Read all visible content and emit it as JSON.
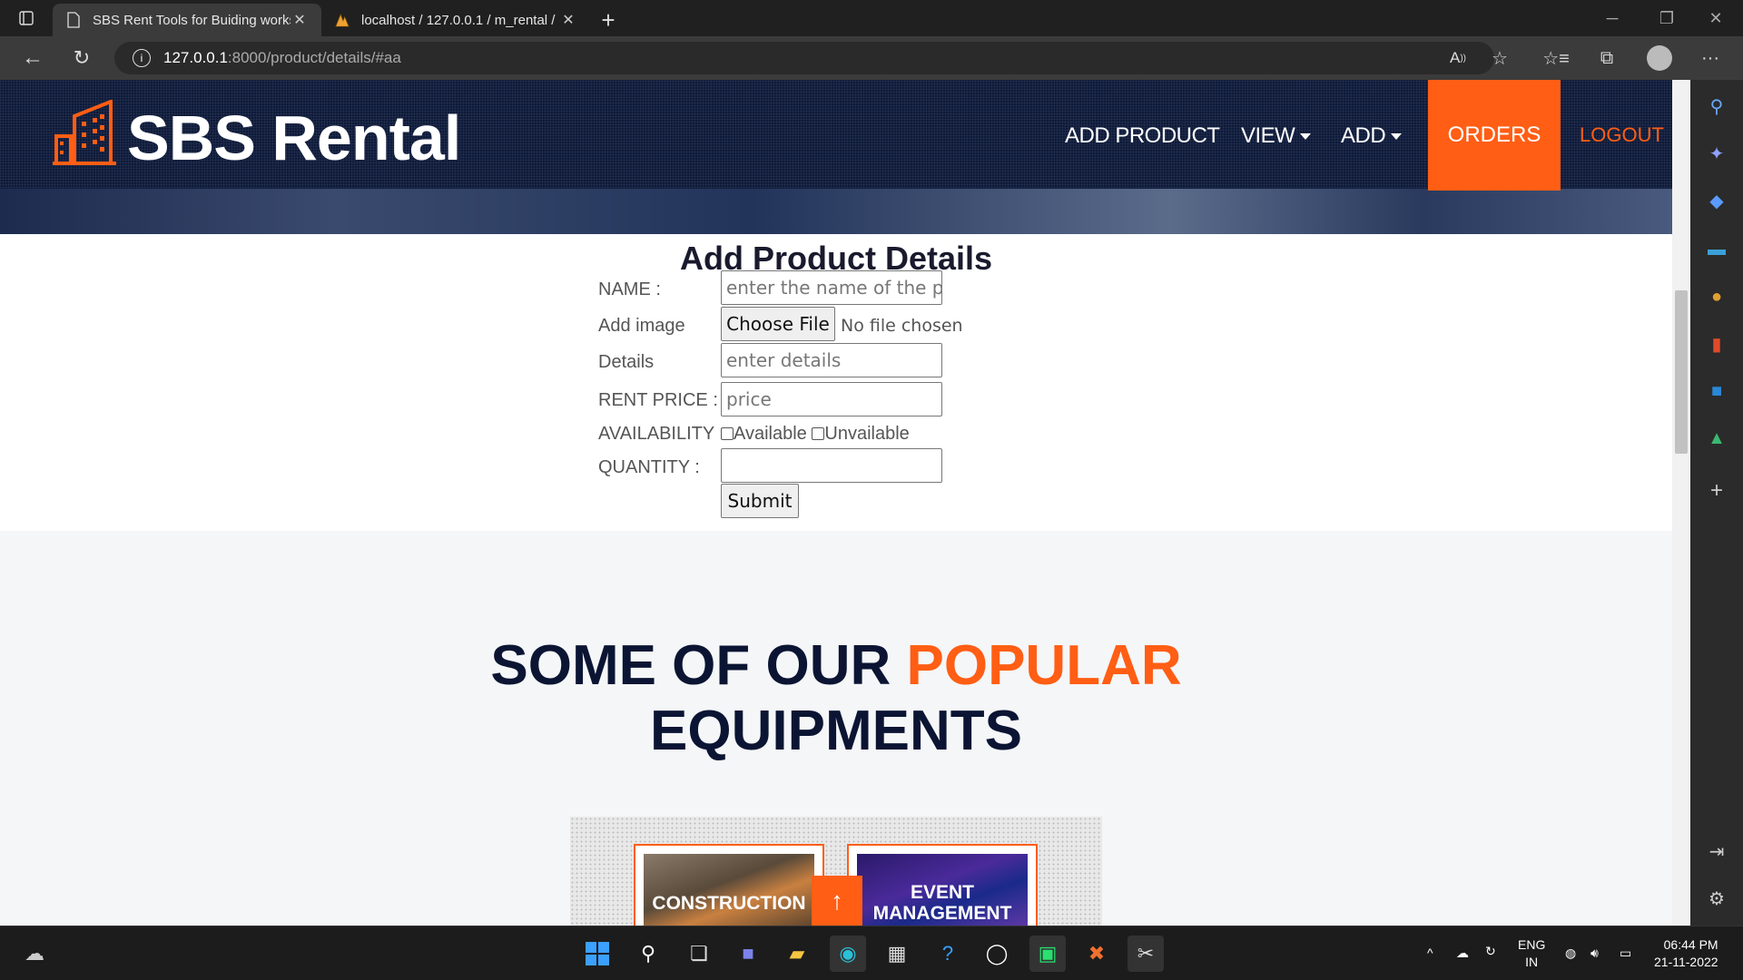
{
  "browser": {
    "tabs": [
      {
        "title": "SBS Rent Tools for Buiding works",
        "icon": "page-icon",
        "active": true
      },
      {
        "title": "localhost / 127.0.0.1 / m_rental /",
        "icon": "phpmyadmin-icon",
        "active": false
      }
    ],
    "url_host": "127.0.0.1",
    "url_path": ":8000/product/details/#aa"
  },
  "site": {
    "brand": "SBS Rental",
    "nav": {
      "add_product": "ADD PRODUCT",
      "view": "VIEW",
      "add": "ADD",
      "orders": "ORDERS",
      "logout": "LOGOUT"
    },
    "accent_color": "#ff5e14",
    "header_color": "#0e1a3a"
  },
  "form": {
    "title": "Add Product Details",
    "name_label": "NAME :",
    "name_placeholder": "enter the name of the product",
    "image_label": "Add image",
    "choose_file": "Choose File",
    "no_file": "No file chosen",
    "details_label": "Details",
    "details_placeholder": "enter details",
    "price_label": "RENT PRICE :",
    "price_placeholder": "price",
    "availability_label": "AVAILABILITY :",
    "available": "Available",
    "unavailable": "Unvailable",
    "quantity_label": "QUANTITY :",
    "submit": "Submit"
  },
  "popular": {
    "line1_a": "SOME OF OUR ",
    "line1_b": "POPULAR",
    "line2": "EQUIPMENTS",
    "cards": [
      {
        "title": "CONSTRUCTION"
      },
      {
        "title": "EVENT MANAGEMENT"
      }
    ],
    "to_top": "↑"
  },
  "taskbar": {
    "lang_1": "ENG",
    "lang_2": "IN",
    "time": "06:44 PM",
    "date": "21-11-2022"
  }
}
